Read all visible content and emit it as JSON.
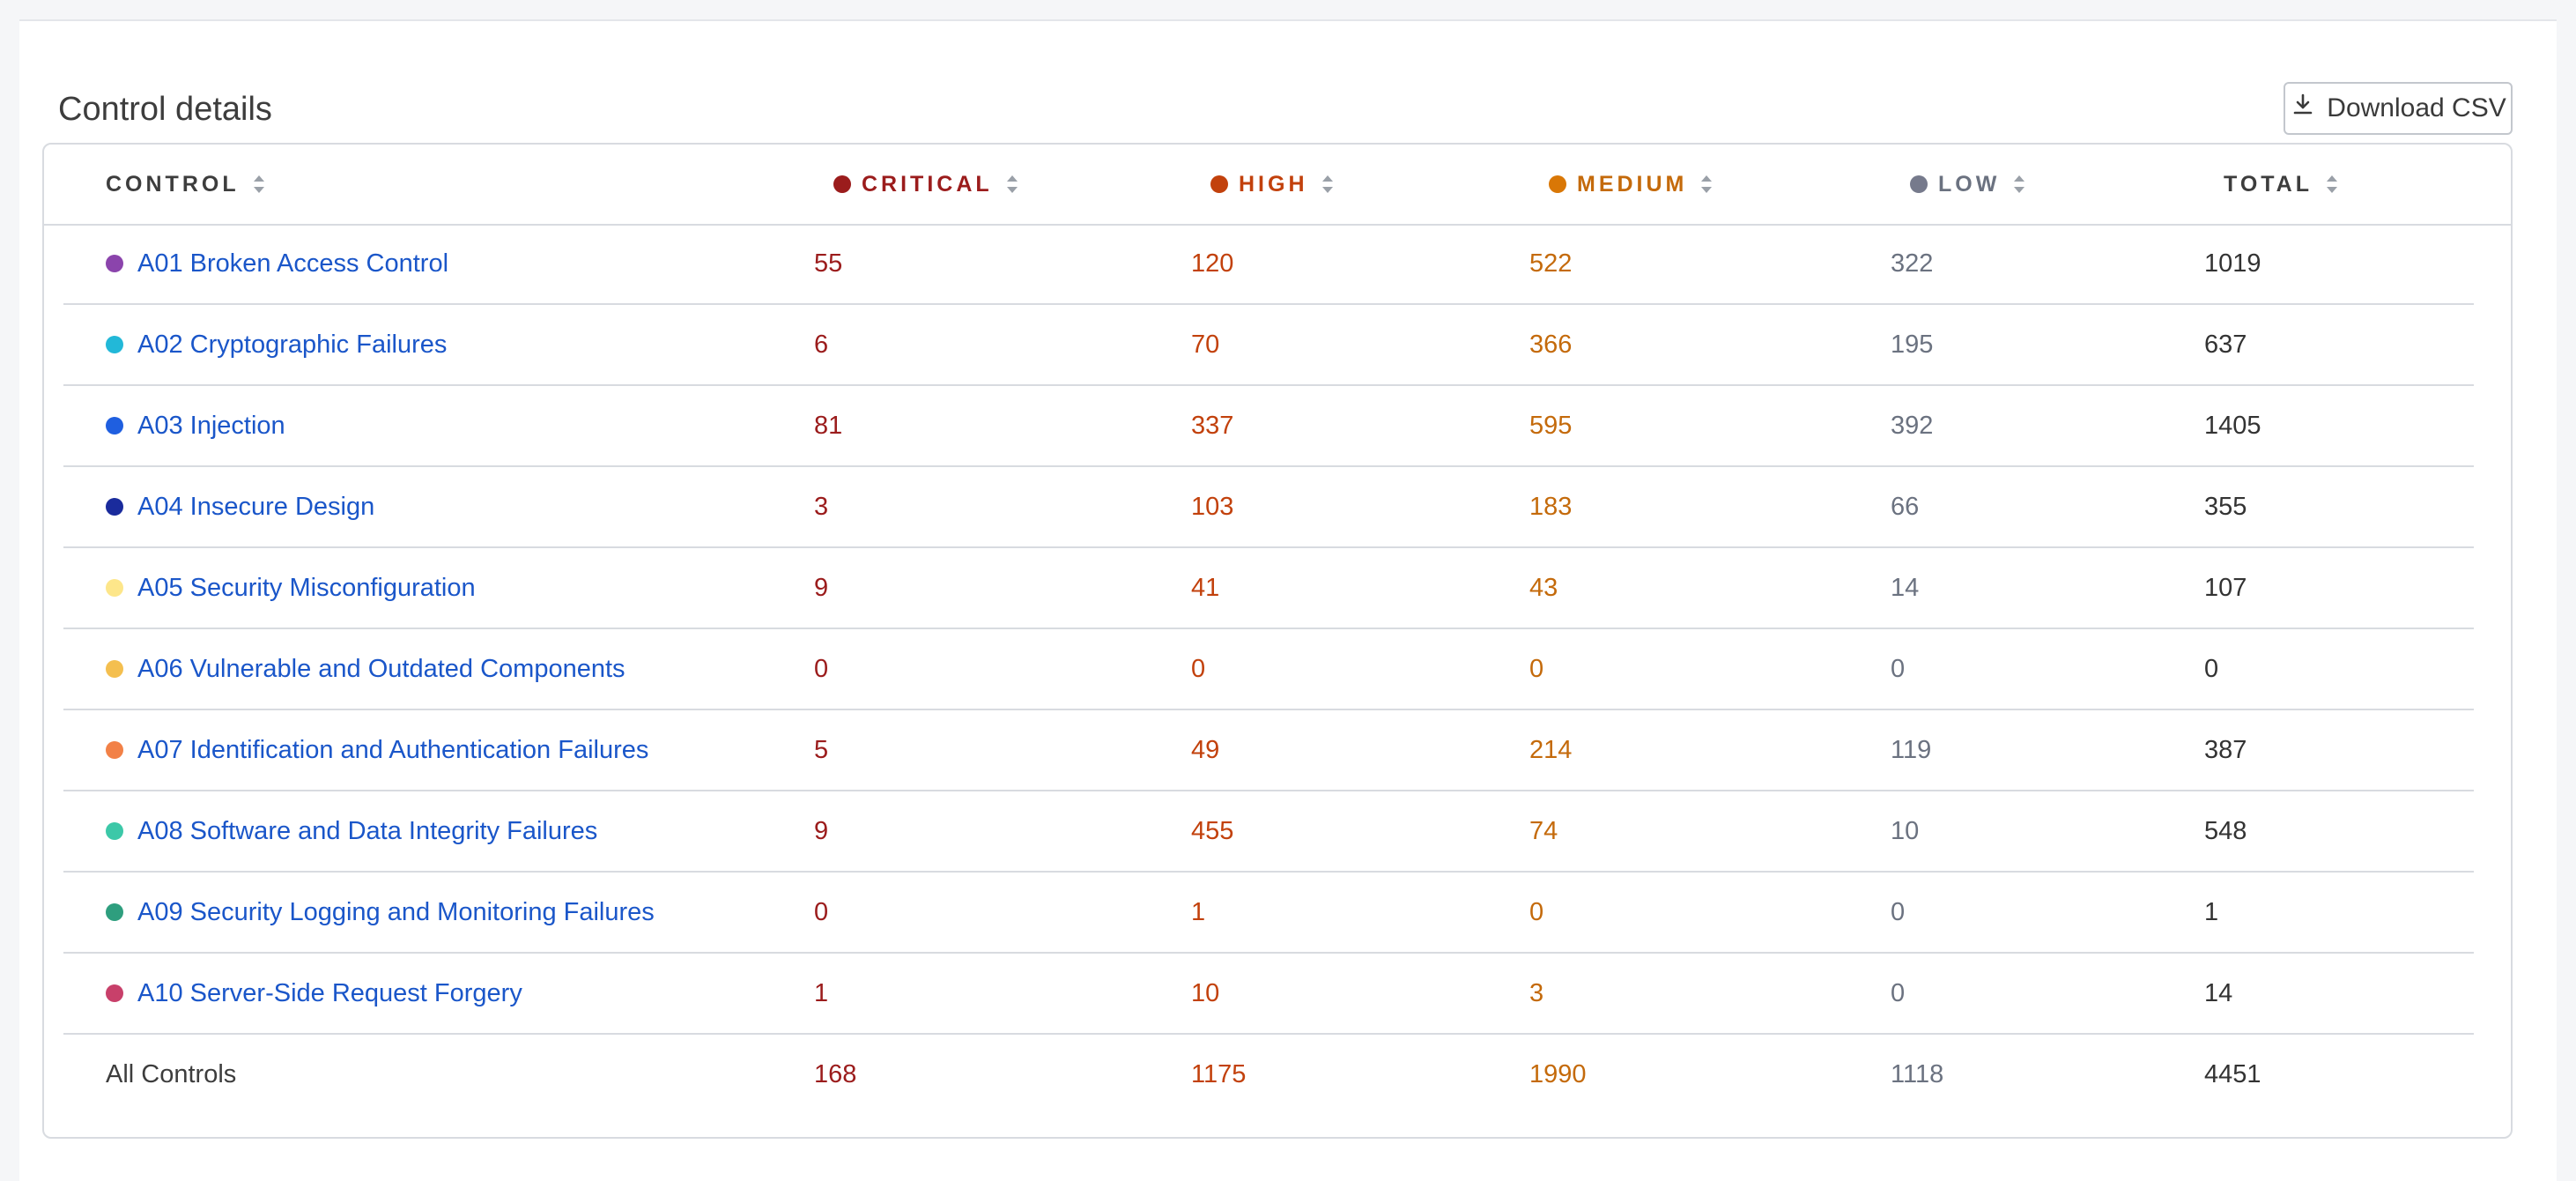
{
  "section": {
    "title": "Control details",
    "download_label": "Download CSV"
  },
  "colors": {
    "critical": "#9b1c1c",
    "high": "#c2410c",
    "medium": "#c46a0b",
    "low": "#6b7280",
    "link": "#1a56c9"
  },
  "table": {
    "headers": {
      "control": "CONTROL",
      "critical": "CRITICAL",
      "high": "HIGH",
      "medium": "MEDIUM",
      "low": "LOW",
      "total": "TOTAL"
    },
    "rows": [
      {
        "name": "A01 Broken Access Control",
        "dot": "#8b44ac",
        "critical": "55",
        "high": "120",
        "medium": "522",
        "low": "322",
        "total": "1019"
      },
      {
        "name": "A02 Cryptographic Failures",
        "dot": "#22b8d8",
        "critical": "6",
        "high": "70",
        "medium": "366",
        "low": "195",
        "total": "637"
      },
      {
        "name": "A03 Injection",
        "dot": "#1f5fe0",
        "critical": "81",
        "high": "337",
        "medium": "595",
        "low": "392",
        "total": "1405"
      },
      {
        "name": "A04 Insecure Design",
        "dot": "#1a2b9c",
        "critical": "3",
        "high": "103",
        "medium": "183",
        "low": "66",
        "total": "355"
      },
      {
        "name": "A05 Security Misconfiguration",
        "dot": "#fde68a",
        "critical": "9",
        "high": "41",
        "medium": "43",
        "low": "14",
        "total": "107"
      },
      {
        "name": "A06 Vulnerable and Outdated Components",
        "dot": "#f4bf4f",
        "critical": "0",
        "high": "0",
        "medium": "0",
        "low": "0",
        "total": "0"
      },
      {
        "name": "A07 Identification and Authentication Failures",
        "dot": "#f28147",
        "critical": "5",
        "high": "49",
        "medium": "214",
        "low": "119",
        "total": "387"
      },
      {
        "name": "A08 Software and Data Integrity Failures",
        "dot": "#3cc8a8",
        "critical": "9",
        "high": "455",
        "medium": "74",
        "low": "10",
        "total": "548"
      },
      {
        "name": "A09 Security Logging and Monitoring Failures",
        "dot": "#2e9e7e",
        "critical": "0",
        "high": "1",
        "medium": "0",
        "low": "0",
        "total": "1"
      },
      {
        "name": "A10 Server-Side Request Forgery",
        "dot": "#c8406a",
        "critical": "1",
        "high": "10",
        "medium": "3",
        "low": "0",
        "total": "14"
      }
    ],
    "totals": {
      "label": "All Controls",
      "critical": "168",
      "high": "1175",
      "medium": "1990",
      "low": "1118",
      "total": "4451"
    }
  }
}
